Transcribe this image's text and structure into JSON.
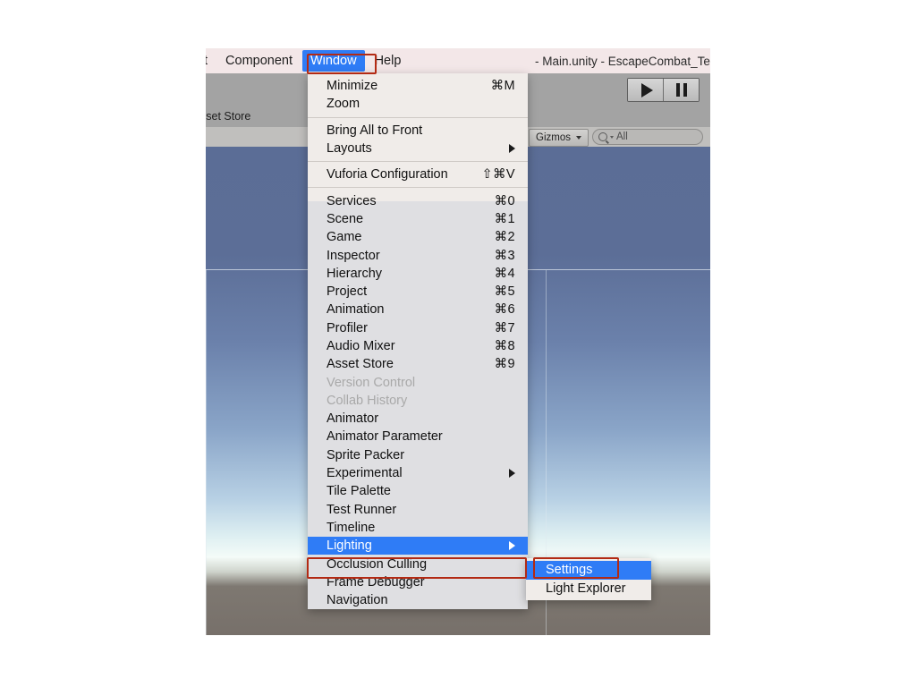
{
  "window": {
    "title_fragment": "- Main.unity - EscapeCombat_Te",
    "tab_label_truncated": "sset Store"
  },
  "menubar": {
    "items": [
      {
        "label": "t",
        "active": false,
        "truncated": true
      },
      {
        "label": "Component",
        "active": false,
        "truncated": false
      },
      {
        "label": "Window",
        "active": true,
        "truncated": false
      },
      {
        "label": "Help",
        "active": false,
        "truncated": false
      }
    ]
  },
  "toolbar": {
    "play_label": "Play",
    "pause_label": "Pause",
    "gizmos_label": "Gizmos",
    "search_value": "All",
    "search_placeholder": "All"
  },
  "window_menu": {
    "groups": [
      {
        "items": [
          {
            "label": "Minimize",
            "shortcut": "⌘M",
            "state": "normal",
            "submenu": false
          },
          {
            "label": "Zoom",
            "shortcut": "",
            "state": "normal",
            "submenu": false
          }
        ]
      },
      {
        "items": [
          {
            "label": "Bring All to Front",
            "shortcut": "",
            "state": "normal",
            "submenu": false
          },
          {
            "label": "Layouts",
            "shortcut": "",
            "state": "normal",
            "submenu": true
          }
        ]
      },
      {
        "items": [
          {
            "label": "Vuforia Configuration",
            "shortcut": "⇧⌘V",
            "state": "normal",
            "submenu": false
          }
        ]
      },
      {
        "items": [
          {
            "label": "Services",
            "shortcut": "⌘0",
            "state": "normal",
            "submenu": false
          },
          {
            "label": "Scene",
            "shortcut": "⌘1",
            "state": "normal",
            "submenu": false
          },
          {
            "label": "Game",
            "shortcut": "⌘2",
            "state": "normal",
            "submenu": false
          },
          {
            "label": "Inspector",
            "shortcut": "⌘3",
            "state": "normal",
            "submenu": false
          },
          {
            "label": "Hierarchy",
            "shortcut": "⌘4",
            "state": "normal",
            "submenu": false
          },
          {
            "label": "Project",
            "shortcut": "⌘5",
            "state": "normal",
            "submenu": false
          },
          {
            "label": "Animation",
            "shortcut": "⌘6",
            "state": "normal",
            "submenu": false
          },
          {
            "label": "Profiler",
            "shortcut": "⌘7",
            "state": "normal",
            "submenu": false
          },
          {
            "label": "Audio Mixer",
            "shortcut": "⌘8",
            "state": "normal",
            "submenu": false
          },
          {
            "label": "Asset Store",
            "shortcut": "⌘9",
            "state": "normal",
            "submenu": false
          },
          {
            "label": "Version Control",
            "shortcut": "",
            "state": "disabled",
            "submenu": false
          },
          {
            "label": "Collab History",
            "shortcut": "",
            "state": "disabled",
            "submenu": false
          },
          {
            "label": "Animator",
            "shortcut": "",
            "state": "normal",
            "submenu": false
          },
          {
            "label": "Animator Parameter",
            "shortcut": "",
            "state": "normal",
            "submenu": false
          },
          {
            "label": "Sprite Packer",
            "shortcut": "",
            "state": "normal",
            "submenu": false
          },
          {
            "label": "Experimental",
            "shortcut": "",
            "state": "normal",
            "submenu": true
          },
          {
            "label": "Tile Palette",
            "shortcut": "",
            "state": "normal",
            "submenu": false
          },
          {
            "label": "Test Runner",
            "shortcut": "",
            "state": "normal",
            "submenu": false
          },
          {
            "label": "Timeline",
            "shortcut": "",
            "state": "normal",
            "submenu": false
          },
          {
            "label": "Lighting",
            "shortcut": "",
            "state": "highlight",
            "submenu": true
          },
          {
            "label": "Occlusion Culling",
            "shortcut": "",
            "state": "normal",
            "submenu": false
          },
          {
            "label": "Frame Debugger",
            "shortcut": "",
            "state": "normal",
            "submenu": false
          },
          {
            "label": "Navigation",
            "shortcut": "",
            "state": "normal",
            "submenu": false
          }
        ]
      }
    ]
  },
  "lighting_submenu": {
    "items": [
      {
        "label": "Settings",
        "state": "highlight"
      },
      {
        "label": "Light Explorer",
        "state": "normal"
      }
    ]
  },
  "annotations": {
    "window_menu_box": "Window",
    "lighting_box": "Lighting",
    "settings_box": "Settings",
    "color": "#b32a14"
  },
  "colors": {
    "menubar_bg": "#f3e7e8",
    "menu_bg": "#f0ece9",
    "highlight_blue": "#2f7cf6",
    "annotation_red": "#b32a14",
    "disabled_text": "#a9a9a9"
  }
}
